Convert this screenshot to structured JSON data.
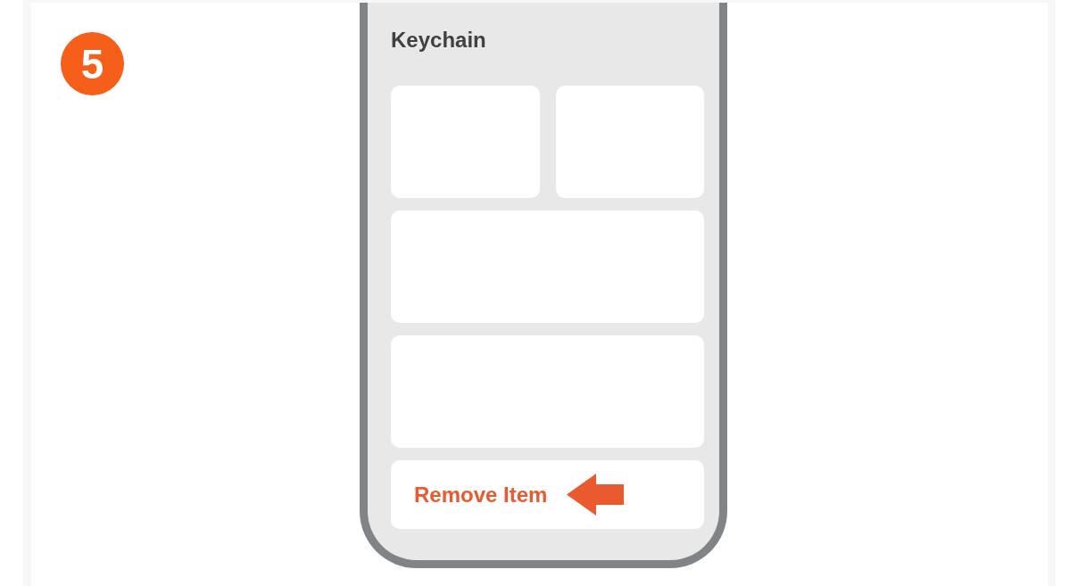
{
  "step": {
    "number": "5"
  },
  "phone": {
    "title": "Keychain",
    "cards": [
      {
        "kind": "half"
      },
      {
        "kind": "half"
      },
      {
        "kind": "wide"
      },
      {
        "kind": "wide"
      }
    ],
    "action": {
      "label": "Remove Item"
    }
  }
}
